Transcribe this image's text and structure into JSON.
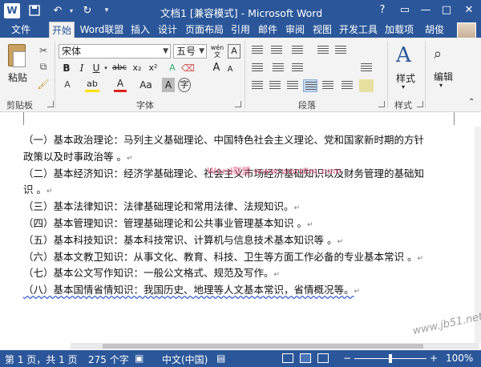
{
  "titlebar": {
    "logo_letter": "W",
    "title": "文档1 [兼容模式] - Microsoft Word",
    "undo_glyph": "↶",
    "redo_glyph": "↻",
    "help": "?",
    "ribbon_options": "▭",
    "minimize": "—",
    "maximize": "□",
    "close": "✕",
    "accent_color": "#2b579a"
  },
  "tabs": {
    "file": "文件",
    "items": [
      "开始",
      "Word联盟",
      "插入",
      "设计",
      "页面布局",
      "引用",
      "邮件",
      "审阅",
      "视图",
      "开发工具",
      "加载项"
    ],
    "active": "开始",
    "user": "胡俊"
  },
  "ribbon": {
    "clipboard": {
      "paste": "粘贴",
      "group": "剪贴板"
    },
    "font": {
      "font_name": "宋体",
      "font_size": "五号",
      "wen_glyph": "wén",
      "grow": "A",
      "shrink": "A",
      "clear_glyph": "A",
      "bold": "B",
      "italic": "I",
      "underline": "U",
      "strike": "abc",
      "subscript": "x₂",
      "superscript": "x²",
      "highlight": "ab",
      "font_color": "A",
      "change_case": "Aa",
      "char_shade": "A",
      "enclose": "字",
      "group": "字体"
    },
    "paragraph": {
      "group": "段落"
    },
    "styles": {
      "label": "样式",
      "group": "样式"
    },
    "editing": {
      "label": "编辑"
    }
  },
  "document": {
    "lines": [
      "（一）基本政治理论：马列主义基础理论、中国特色社会主义理论、党和国家新时期的方针",
      "政策以及时事政治等 。",
      "（二）基本经济知识：经济学基础理论、社会主义市场经济基础知识以及财务管理的基础知",
      "识 。",
      "（三）基本法律知识：法律基础理论和常用法律、法规知识。",
      "（四）基本管理知识：管理基础理论和公共事业管理基本知识 。",
      "（五）基本科技知识：基本科技常识、计算机与信息技术基本知识等 。",
      "（六）基本文教卫知识：从事文化、教育、科技、卫生等方面工作必备的专业基本常识 。",
      "（七）基本公文写作知识：一般公文格式、规范及写作。",
      "（八）基本国情省情知识：我国历史、地理等人文基本常识，省情概况等。"
    ],
    "paragraph_mark": "↵",
    "overlay_text": "Word联盟 www.wordlm.com",
    "site_watermark": "www.jb51.net"
  },
  "status": {
    "page": "第 1 页，共 1 页",
    "words": "275 个字",
    "language": "中文(中国)",
    "zoom": "100%",
    "zoom_value": 100,
    "minus": "−",
    "plus": "+"
  }
}
